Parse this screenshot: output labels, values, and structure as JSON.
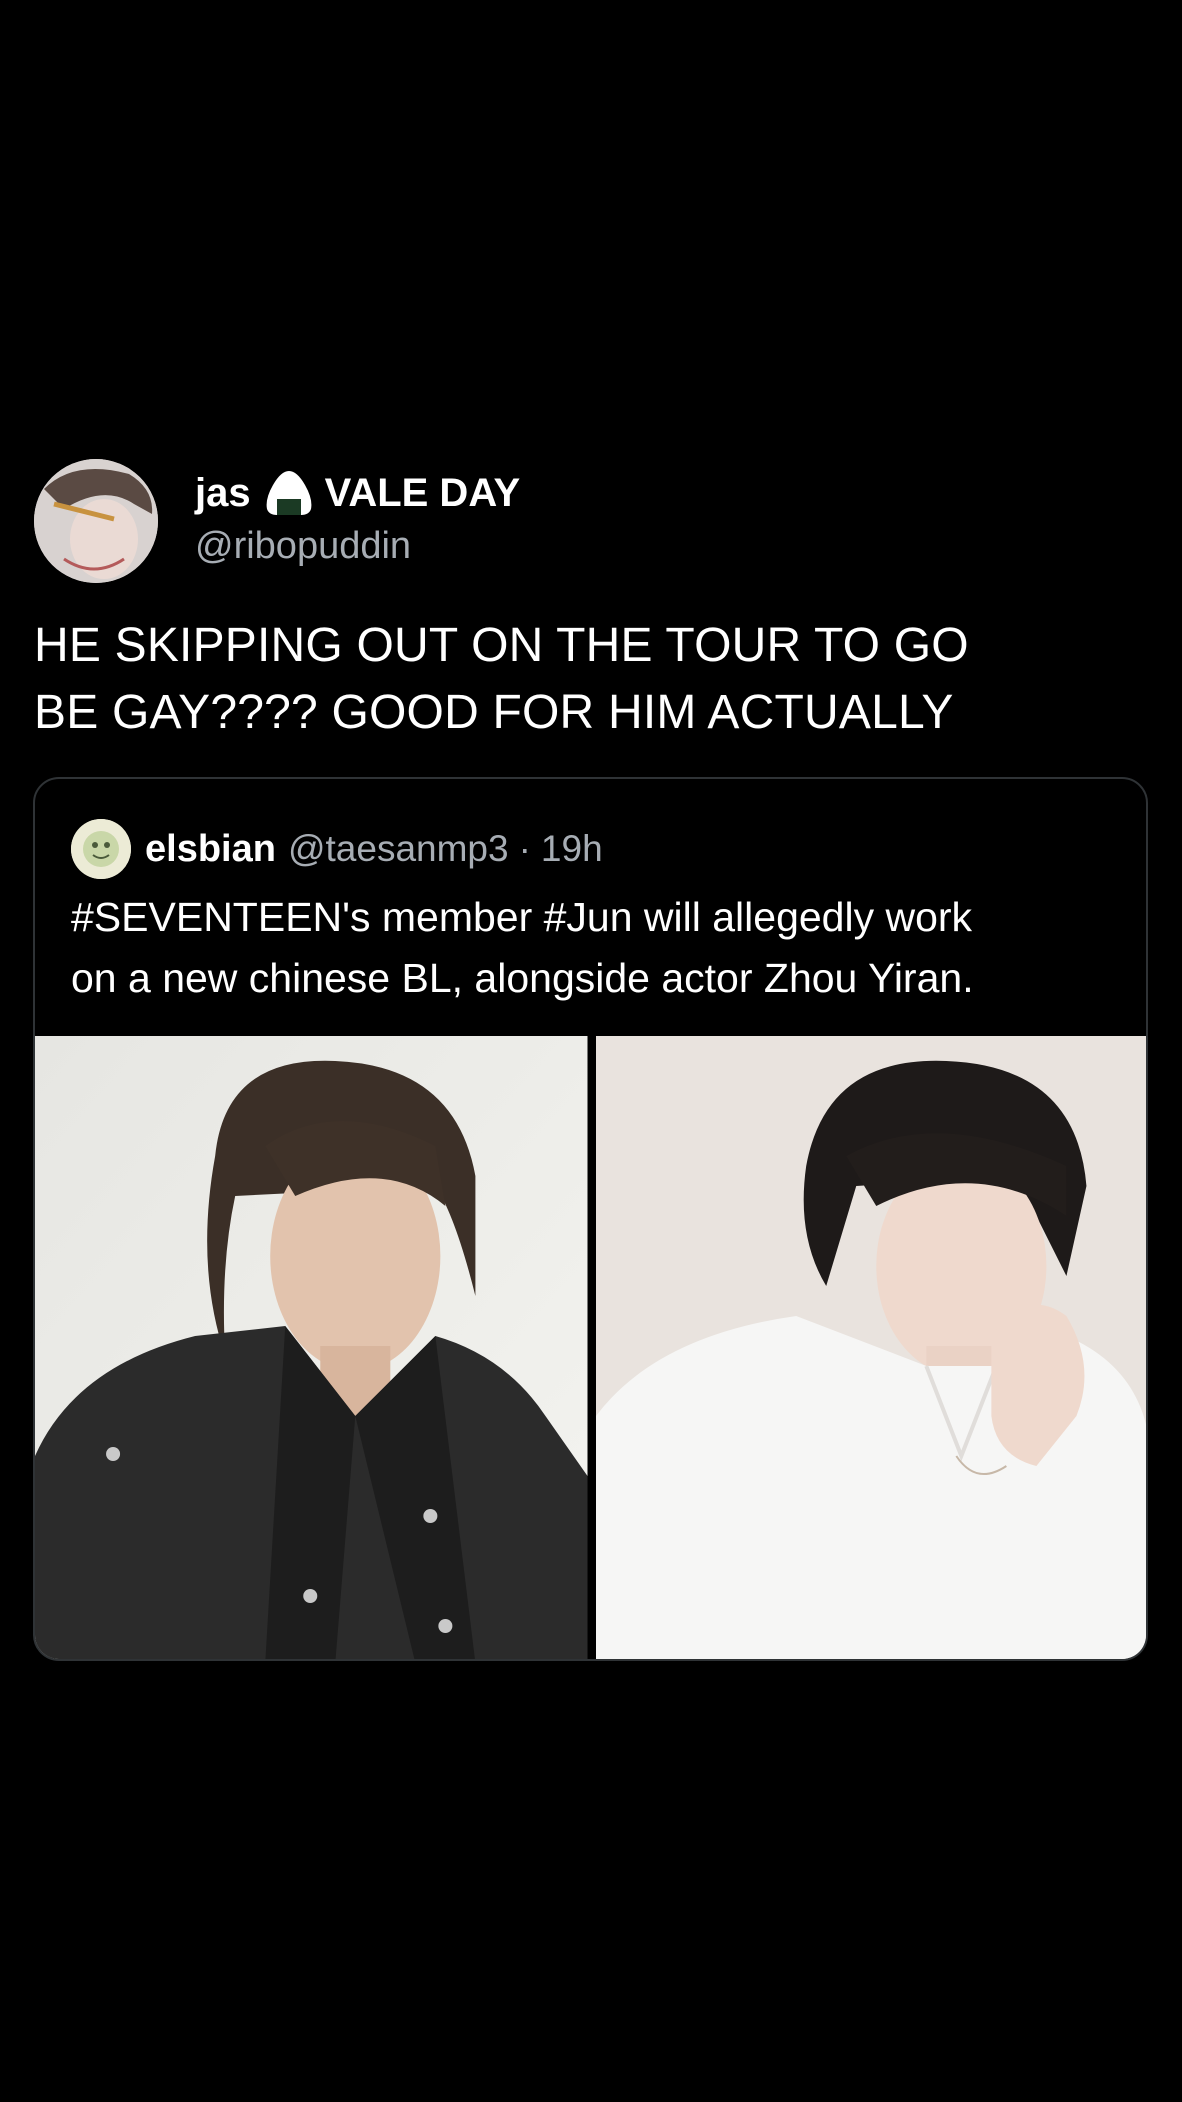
{
  "post": {
    "author": {
      "name": "jas",
      "suffix": "VALE DAY",
      "emoji_icon": "onigiri-icon",
      "handle": "@ribopuddin"
    },
    "text": "HE SKIPPING OUT ON THE TOUR TO GO\nBE GAY???? GOOD FOR HIM ACTUALLY",
    "quote": {
      "author_name": "elsbian",
      "author_handle": "@taesanmp3",
      "separator": "·",
      "time": "19h",
      "text": "#SEVENTEEN's member #Jun will allegedly work\non a new chinese BL, alongside actor Zhou Yiran.",
      "photos": [
        {
          "icon": "portrait-photo-left"
        },
        {
          "icon": "portrait-photo-right"
        }
      ]
    }
  },
  "colors": {
    "background": "#000000",
    "text_primary": "#ffffff",
    "text_secondary": "#a7adb4",
    "card_border": "#2f3336"
  }
}
